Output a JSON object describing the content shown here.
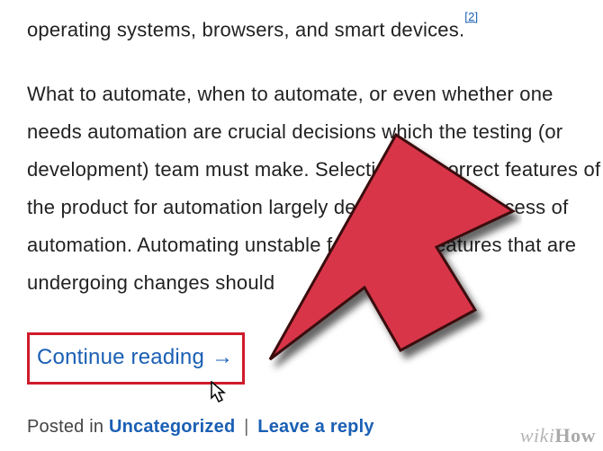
{
  "para1_tail": "operating systems, browsers, and smart devices.",
  "ref_marker": "[2]",
  "para2": "What to automate, when to automate, or even whether one needs automation are crucial decisions which the testing (or development) team must make. Selecting the correct features of the product for automation largely determines the success of automation. Automating unstable features or features that are undergoing changes should",
  "continue_label": "Continue reading",
  "meta": {
    "posted_in": "Posted in ",
    "category": "Uncategorized",
    "reply": "Leave a reply"
  },
  "watermark": {
    "wiki": "wiki",
    "how": "How"
  }
}
